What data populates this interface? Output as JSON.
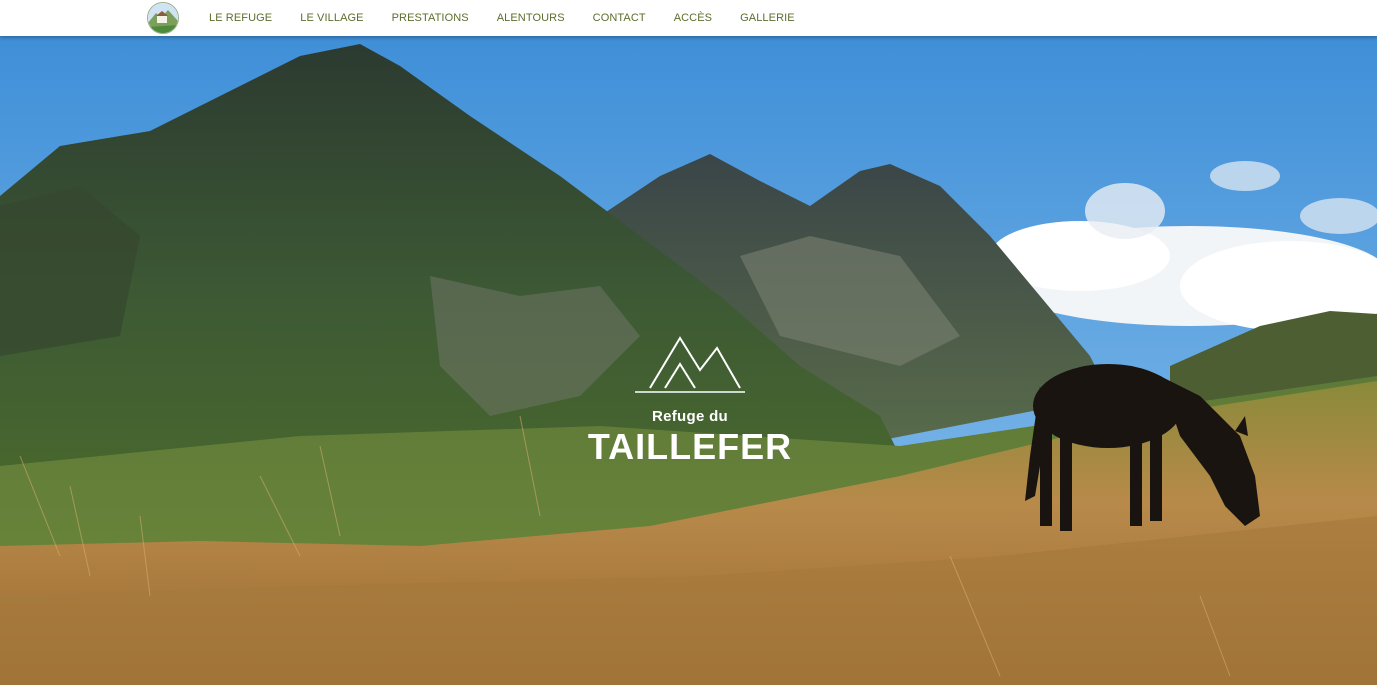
{
  "nav": {
    "logo_name": "refuge-logo",
    "items": [
      {
        "label": "LE REFUGE"
      },
      {
        "label": "LE VILLAGE"
      },
      {
        "label": "PRESTATIONS"
      },
      {
        "label": "ALENTOURS"
      },
      {
        "label": "CONTACT"
      },
      {
        "label": "ACCÈS"
      },
      {
        "label": "GALLERIE"
      }
    ]
  },
  "hero": {
    "brand_line1": "Refuge du",
    "brand_line2": "TAILLEFER"
  },
  "colors": {
    "nav_link": "#5a6e2c",
    "sky": "#5aa6e6",
    "brand_text": "#ffffff"
  }
}
